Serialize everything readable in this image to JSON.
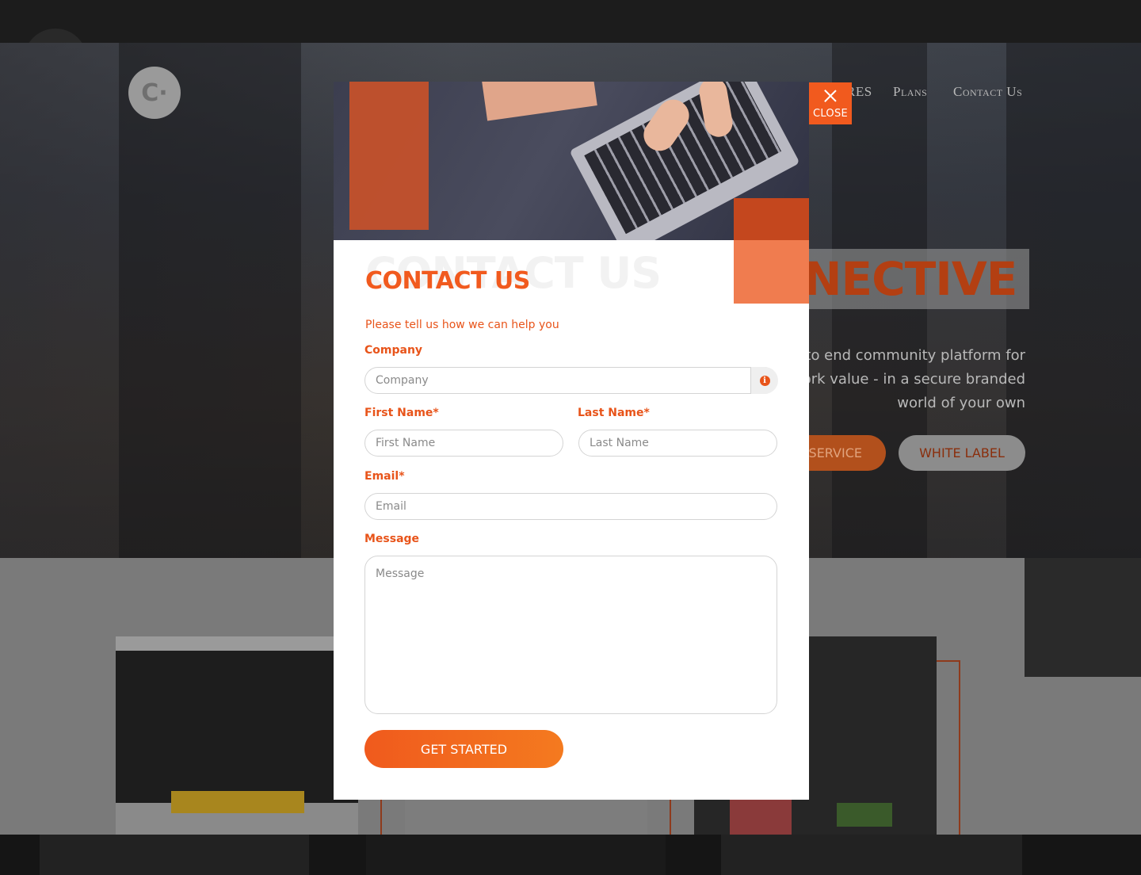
{
  "background": {
    "logo_glyph": "C·",
    "nav": {
      "features_partial": "RES",
      "plans": "Plans",
      "contact": "Contact Us"
    },
    "hero_title_partial": "NECTIVE",
    "tagline": [
      "nd to end community platform for",
      "etwork value - in a secure branded",
      "world of your own"
    ],
    "btn_self_service_partial": "F-SERVICE",
    "btn_white_label": "WHITE LABEL"
  },
  "modal": {
    "close_label": "CLOSE",
    "ghost_title": "CONTACT US",
    "title": "CONTACT US",
    "subtitle": "Please tell us how we can help you",
    "company": {
      "label": "Company",
      "placeholder": "Company"
    },
    "first_name": {
      "label": "First Name*",
      "placeholder": "First Name"
    },
    "last_name": {
      "label": "Last Name*",
      "placeholder": "Last Name"
    },
    "email": {
      "label": "Email*",
      "placeholder": "Email"
    },
    "message": {
      "label": "Message",
      "placeholder": "Message"
    },
    "submit_label": "GET STARTED",
    "info_glyph": "i"
  },
  "colors": {
    "accent": "#f15a1e",
    "overlay_dark": "#2a2a2a"
  }
}
